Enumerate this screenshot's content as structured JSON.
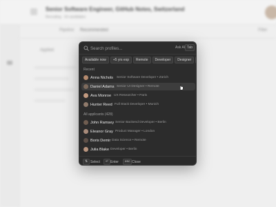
{
  "background": {
    "title": "Senior Software Engineer, GitHub Notes, Switzerland",
    "subtitle": "Recruiting · 24 candidates",
    "tabs": [
      "Pipeline",
      "Recommended",
      "Filter"
    ],
    "filter_label": "Applied"
  },
  "palette": {
    "search": {
      "placeholder": "Search profiles...",
      "value": ""
    },
    "ask_ai": "Ask AI",
    "tab_key": "Tab",
    "chips": [
      "Available now",
      "+5 yrs exp",
      "Remote",
      "Developer",
      "Designer",
      "Mo"
    ],
    "recent_label": "Recent",
    "all_label": "All applicants (428)",
    "recent": [
      {
        "name": "Anna Nichols",
        "meta": "Senior Software Developer • Zürich",
        "avatar_color": "#b48a6e"
      },
      {
        "name": "Daniel Adams",
        "meta": "Senior UI Designer • Remote",
        "avatar_color": "#7d6a5c"
      },
      {
        "name": "Ava Monroe",
        "meta": "UX Researcher • Paris",
        "avatar_color": "#c29a80"
      },
      {
        "name": "Hunter Reed",
        "meta": "Full Stack Developer • Munich",
        "avatar_color": "#8f7a6b"
      }
    ],
    "all": [
      {
        "name": "John Ramsey",
        "meta": "Senior Backend Developer • Berlin",
        "avatar_color": "#6f5d50"
      },
      {
        "name": "Eleanor Gray",
        "meta": "Product Manager • London",
        "avatar_color": "#a88b7a"
      },
      {
        "name": "Boris Demir",
        "meta": "Data Science • Remote",
        "avatar_color": "#5e5048"
      },
      {
        "name": "Julia Blake",
        "meta": "Developer • Berlin",
        "avatar_color": "#b9957f"
      }
    ],
    "highlighted_row": "Daniel Adams",
    "footer": {
      "select_key": "⇅",
      "select_label": "Select",
      "enter_key": "↵",
      "enter_label": "Enter",
      "esc_key": "esc",
      "esc_label": "Close"
    }
  }
}
